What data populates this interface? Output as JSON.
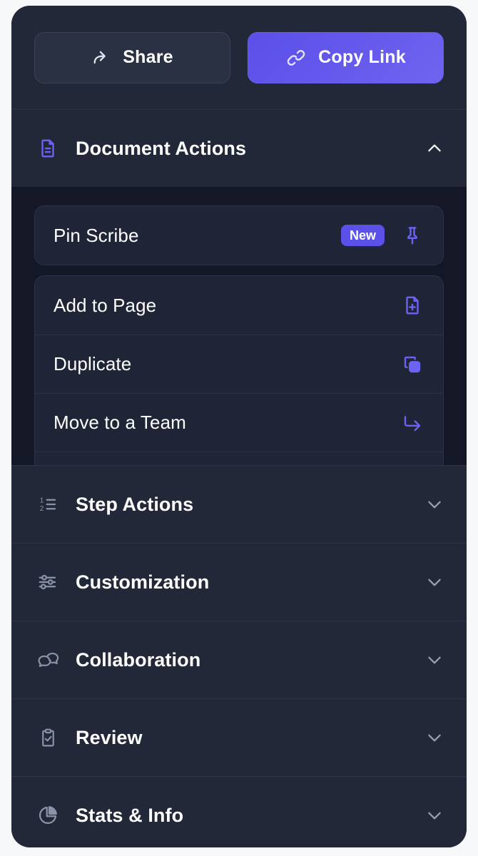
{
  "colors": {
    "page_background": "#f7f8fa",
    "panel_background": "#222838",
    "expanded_background": "#141726",
    "card_background": "#1f2536",
    "accent": "#5b50e8",
    "accent_icon": "#6c63f5",
    "muted_icon": "#8a93a8",
    "text": "#ffffff",
    "divider": "#2e3548"
  },
  "toolbar": {
    "share_label": "Share",
    "share_icon": "share-arrow-icon",
    "copy_link_label": "Copy Link",
    "copy_link_icon": "link-chain-icon"
  },
  "sections": [
    {
      "id": "document-actions",
      "label": "Document Actions",
      "icon": "document-file-icon",
      "expanded": true,
      "chevron": "chevron-up-icon",
      "items": [
        {
          "id": "pin-scribe",
          "label": "Pin Scribe",
          "badge": "New",
          "icon": "pushpin-icon",
          "standalone": true
        },
        {
          "id": "add-to-page",
          "label": "Add to Page",
          "badge": "",
          "icon": "file-plus-icon",
          "standalone": false
        },
        {
          "id": "duplicate",
          "label": "Duplicate",
          "badge": "",
          "icon": "copy-duplicate-icon",
          "standalone": false
        },
        {
          "id": "move-to-team",
          "label": "Move to a Team",
          "badge": "",
          "icon": "corner-down-right-arrow-icon",
          "standalone": false
        }
      ]
    },
    {
      "id": "step-actions",
      "label": "Step Actions",
      "icon": "ordered-list-icon",
      "expanded": false,
      "chevron": "chevron-down-icon",
      "items": []
    },
    {
      "id": "customization",
      "label": "Customization",
      "icon": "sliders-icon",
      "expanded": false,
      "chevron": "chevron-down-icon",
      "items": []
    },
    {
      "id": "collaboration",
      "label": "Collaboration",
      "icon": "chat-bubbles-icon",
      "expanded": false,
      "chevron": "chevron-down-icon",
      "items": []
    },
    {
      "id": "review",
      "label": "Review",
      "icon": "clipboard-check-icon",
      "expanded": false,
      "chevron": "chevron-down-icon",
      "items": []
    },
    {
      "id": "stats-info",
      "label": "Stats & Info",
      "icon": "pie-chart-icon",
      "expanded": false,
      "chevron": "chevron-down-icon",
      "items": []
    }
  ]
}
